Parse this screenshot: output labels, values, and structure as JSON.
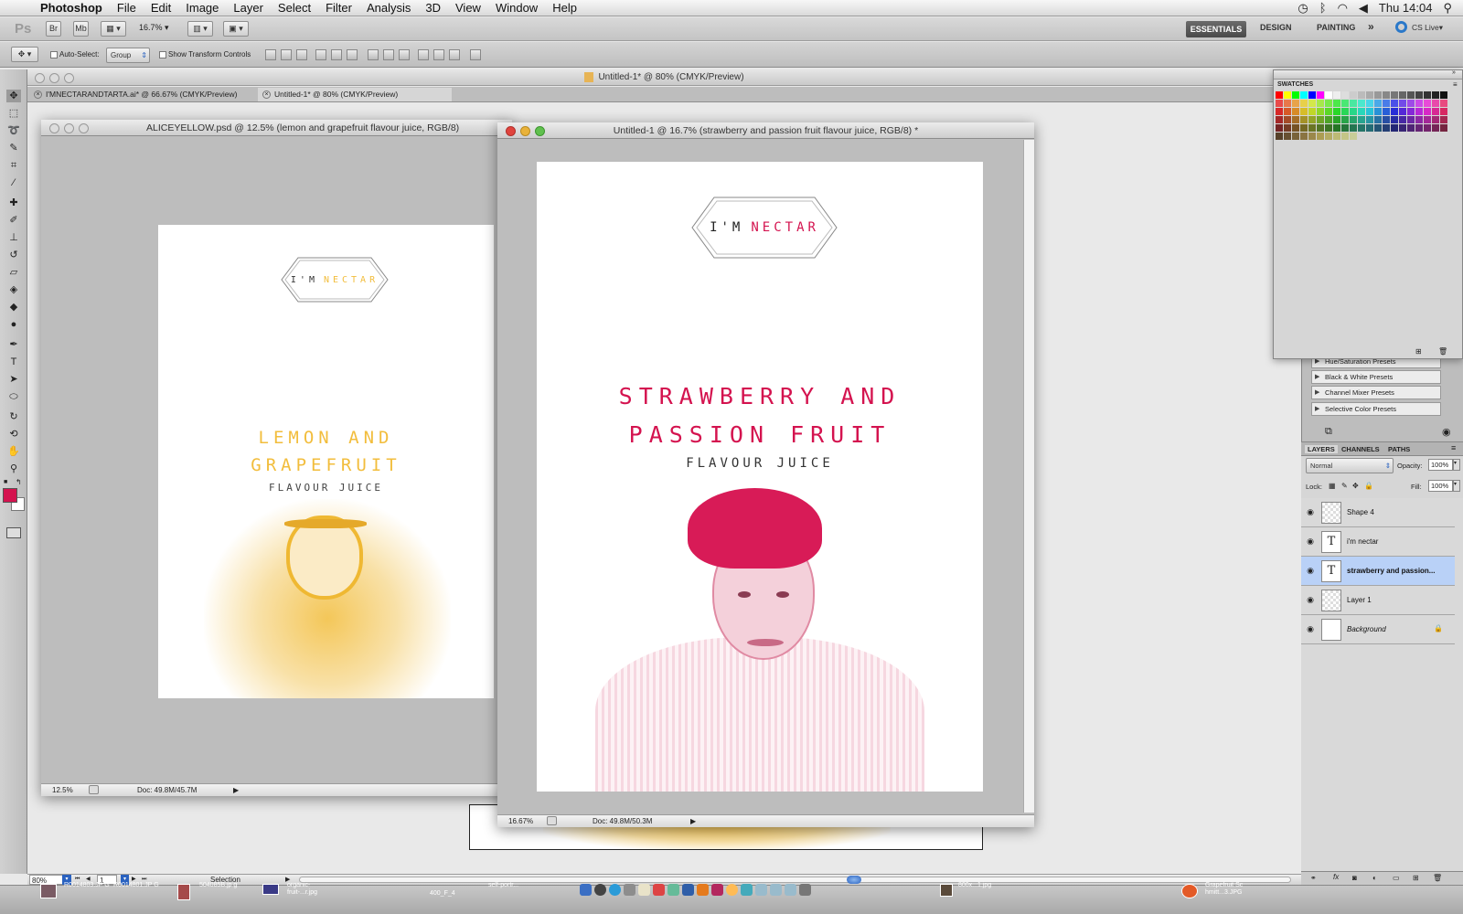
{
  "menubar": {
    "app": "Photoshop",
    "items": [
      "File",
      "Edit",
      "Image",
      "Layer",
      "Select",
      "Filter",
      "Analysis",
      "3D",
      "View",
      "Window",
      "Help"
    ],
    "clock": "Thu 14:04"
  },
  "appbar": {
    "bridge": "Br",
    "minibridge": "Mb",
    "zoom": "16.7%",
    "workspaces": [
      "ESSENTIALS",
      "DESIGN",
      "PAINTING"
    ],
    "more": "»",
    "cslive": "CS Live"
  },
  "options": {
    "auto_select": "Auto-Select:",
    "group": "Group",
    "show_transform": "Show Transform Controls"
  },
  "window_title": "Untitled-1* @ 80% (CMYK/Preview)",
  "tabs": [
    "I'MNECTARANDTARTA.ai* @ 66.67% (CMYK/Preview)",
    "Untitled-1* @ 80% (CMYK/Preview)"
  ],
  "doc_lemon": {
    "title": "ALICEYELLOW.psd @ 12.5% (lemon and grapefruit  flavour juice, RGB/8)",
    "logo_a": "I'M",
    "logo_b": "NECTAR",
    "line1": "LEMON AND",
    "line2": "GRAPEFRUIT",
    "sub": "FLAVOUR JUICE",
    "zoom": "12.5%",
    "doc": "Doc: 49.8M/45.7M",
    "accent": "#f2bd3c"
  },
  "doc_straw": {
    "title": "Untitled-1 @ 16.7% (strawberry and passion fruit  flavour juice, RGB/8) *",
    "logo_a": "I'M",
    "logo_b": "NECTAR",
    "line1": "STRAWBERRY AND",
    "line2": "PASSION FRUIT",
    "sub": "FLAVOUR JUICE",
    "zoom": "16.67%",
    "doc": "Doc: 49.8M/50.3M",
    "accent": "#d4134f"
  },
  "swatches": {
    "tab": "SWATCHES"
  },
  "adjustments": {
    "presets": [
      "Hue/Saturation Presets",
      "Black & White Presets",
      "Channel Mixer Presets",
      "Selective Color Presets"
    ]
  },
  "layers_panel": {
    "tabs": [
      "LAYERS",
      "CHANNELS",
      "PATHS"
    ],
    "blend": "Normal",
    "opacity_label": "Opacity:",
    "opacity": "100%",
    "lock_label": "Lock:",
    "fill_label": "Fill:",
    "fill": "100%",
    "layers": [
      {
        "name": "Shape 4",
        "kind": "shape"
      },
      {
        "name": "i'm nectar",
        "kind": "text"
      },
      {
        "name": "strawberry and passion...",
        "kind": "text"
      },
      {
        "name": "Layer 1",
        "kind": "pixel"
      },
      {
        "name": "Background",
        "kind": "background"
      }
    ]
  },
  "bottom_status": {
    "zoom": "80%",
    "page": "1",
    "mode": "Selection"
  },
  "dock": {
    "items": [
      "R0014803.JP G",
      "R0014801.JP G",
      "504085B.jp g",
      "organic-fruit-...r.jpg",
      "400_F_4",
      "self-portr...",
      "800x...1.jpg",
      "Grapefruit Sc hmitt...3.JPG"
    ]
  },
  "colors": {
    "foreground": "#d4134f",
    "selection": "#b9d1f7"
  }
}
